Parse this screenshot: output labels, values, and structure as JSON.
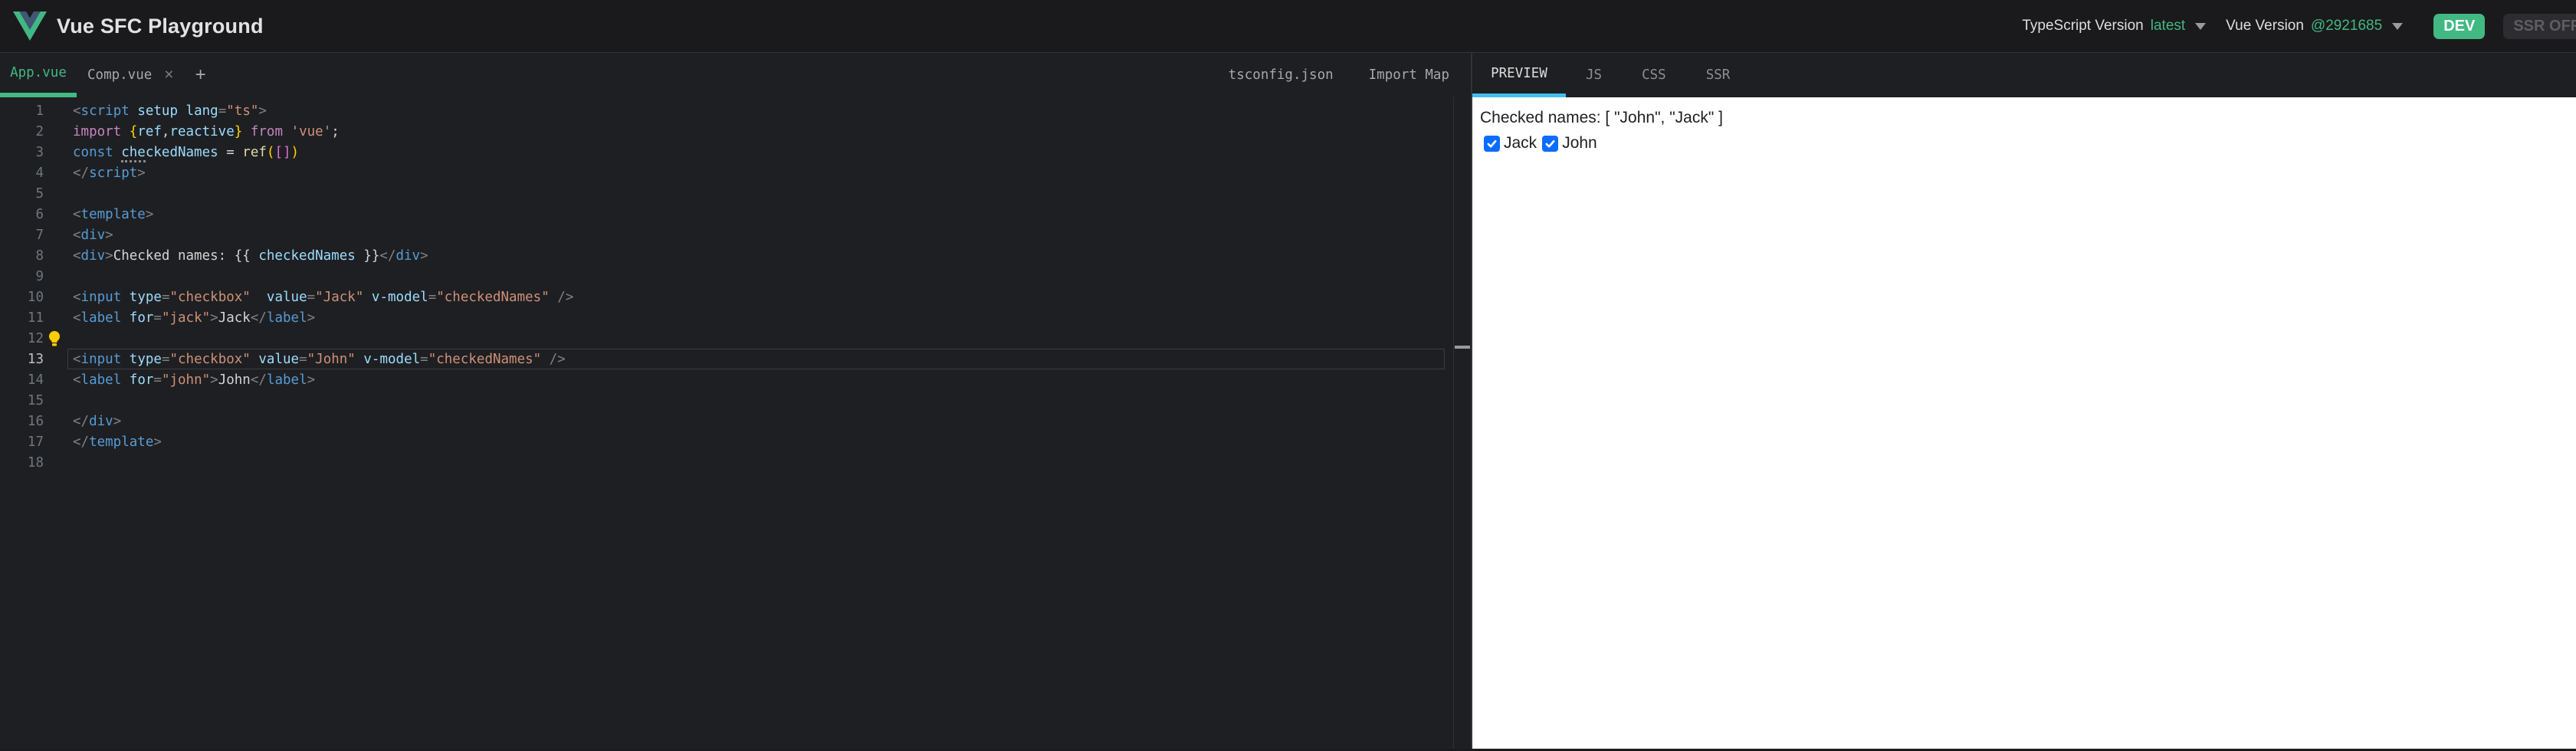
{
  "header": {
    "title": "Vue SFC Playground",
    "ts_version_label": "TypeScript Version",
    "ts_version_value": "latest",
    "vue_version_label": "Vue Version",
    "vue_version_value": "@2921685",
    "dev_badge": "DEV",
    "ssr_badge": "SSR OFF",
    "accent_green": "#42b883"
  },
  "file_tabs": {
    "tabs": [
      {
        "label": "App.vue",
        "active": true
      },
      {
        "label": "Comp.vue",
        "active": false,
        "closable": true
      }
    ],
    "close_label": "×",
    "add_label": "+",
    "right_items": [
      "tsconfig.json",
      "Import Map"
    ]
  },
  "output_tabs": {
    "tabs": [
      {
        "label": "PREVIEW",
        "active": true
      },
      {
        "label": "JS",
        "active": false
      },
      {
        "label": "CSS",
        "active": false
      },
      {
        "label": "SSR",
        "active": false
      }
    ],
    "active_underline_color": "#44bdf0"
  },
  "editor": {
    "current_line": 13,
    "lightbulb_line": 12,
    "lines": [
      {
        "segs": [
          [
            "pu",
            "<"
          ],
          [
            "tag",
            "script"
          ],
          [
            "pl",
            " "
          ],
          [
            "attr",
            "setup"
          ],
          [
            "pl",
            " "
          ],
          [
            "attr",
            "lang"
          ],
          [
            "pu",
            "="
          ],
          [
            "str",
            "\"ts\""
          ],
          [
            "pu",
            ">"
          ]
        ]
      },
      {
        "segs": [
          [
            "kw",
            "import"
          ],
          [
            "pl",
            " "
          ],
          [
            "b1",
            "{"
          ],
          [
            "ident",
            "ref"
          ],
          [
            "pl",
            ","
          ],
          [
            "ident",
            "reactive"
          ],
          [
            "b1",
            "}"
          ],
          [
            "pl",
            " "
          ],
          [
            "kw",
            "from"
          ],
          [
            "pl",
            " "
          ],
          [
            "str",
            "'vue'"
          ],
          [
            "pl",
            ";"
          ]
        ]
      },
      {
        "segs": [
          [
            "decl",
            "const"
          ],
          [
            "pl",
            " "
          ],
          [
            "ident hint",
            "che"
          ],
          [
            "ident",
            "ckedNames"
          ],
          [
            "pl",
            " = "
          ],
          [
            "fn",
            "ref"
          ],
          [
            "b1",
            "("
          ],
          [
            "b2",
            "[]"
          ],
          [
            "b1",
            ")"
          ]
        ]
      },
      {
        "segs": [
          [
            "pu",
            "</"
          ],
          [
            "tag",
            "script"
          ],
          [
            "pu",
            ">"
          ]
        ]
      },
      {
        "segs": []
      },
      {
        "segs": [
          [
            "pu",
            "<"
          ],
          [
            "tag",
            "template"
          ],
          [
            "pu",
            ">"
          ]
        ]
      },
      {
        "segs": [
          [
            "pu",
            "<"
          ],
          [
            "tag",
            "div"
          ],
          [
            "pu",
            ">"
          ]
        ]
      },
      {
        "segs": [
          [
            "pu",
            "<"
          ],
          [
            "tag",
            "div"
          ],
          [
            "pu",
            ">"
          ],
          [
            "pl",
            "Checked names: {{ "
          ],
          [
            "ident",
            "checkedNames"
          ],
          [
            "pl",
            " }}"
          ],
          [
            "pu",
            "</"
          ],
          [
            "tag",
            "div"
          ],
          [
            "pu",
            ">"
          ]
        ]
      },
      {
        "segs": []
      },
      {
        "segs": [
          [
            "pu",
            "<"
          ],
          [
            "tag",
            "input"
          ],
          [
            "pl",
            " "
          ],
          [
            "attr",
            "type"
          ],
          [
            "pu",
            "="
          ],
          [
            "str",
            "\"checkbox\""
          ],
          [
            "pl",
            "  "
          ],
          [
            "attr",
            "value"
          ],
          [
            "pu",
            "="
          ],
          [
            "str",
            "\"Jack\""
          ],
          [
            "pl",
            " "
          ],
          [
            "attr",
            "v-model"
          ],
          [
            "pu",
            "="
          ],
          [
            "str",
            "\"checkedNames\""
          ],
          [
            "pl",
            " "
          ],
          [
            "pu",
            "/>"
          ]
        ]
      },
      {
        "segs": [
          [
            "pu",
            "<"
          ],
          [
            "tag",
            "label"
          ],
          [
            "pl",
            " "
          ],
          [
            "attr",
            "for"
          ],
          [
            "pu",
            "="
          ],
          [
            "str",
            "\"jack\""
          ],
          [
            "pu",
            ">"
          ],
          [
            "pl",
            "Jack"
          ],
          [
            "pu",
            "</"
          ],
          [
            "tag",
            "label"
          ],
          [
            "pu",
            ">"
          ]
        ]
      },
      {
        "segs": []
      },
      {
        "segs": [
          [
            "pu",
            "<"
          ],
          [
            "tag",
            "input"
          ],
          [
            "pl",
            " "
          ],
          [
            "attr",
            "type"
          ],
          [
            "pu",
            "="
          ],
          [
            "str",
            "\"checkbox\""
          ],
          [
            "pl",
            " "
          ],
          [
            "attr",
            "value"
          ],
          [
            "pu",
            "="
          ],
          [
            "str",
            "\"John\""
          ],
          [
            "pl",
            " "
          ],
          [
            "attr",
            "v-model"
          ],
          [
            "pu",
            "="
          ],
          [
            "str",
            "\"checkedNames\""
          ],
          [
            "pl",
            " "
          ],
          [
            "pu",
            "/>"
          ]
        ]
      },
      {
        "segs": [
          [
            "pu",
            "<"
          ],
          [
            "tag",
            "label"
          ],
          [
            "pl",
            " "
          ],
          [
            "attr",
            "for"
          ],
          [
            "pu",
            "="
          ],
          [
            "str",
            "\"john\""
          ],
          [
            "pu",
            ">"
          ],
          [
            "pl",
            "John"
          ],
          [
            "pu",
            "</"
          ],
          [
            "tag",
            "label"
          ],
          [
            "pu",
            ">"
          ]
        ]
      },
      {
        "segs": []
      },
      {
        "segs": [
          [
            "pu",
            "</"
          ],
          [
            "tag",
            "div"
          ],
          [
            "pu",
            ">"
          ]
        ]
      },
      {
        "segs": [
          [
            "pu",
            "</"
          ],
          [
            "tag",
            "template"
          ],
          [
            "pu",
            ">"
          ]
        ]
      },
      {
        "segs": []
      }
    ]
  },
  "preview": {
    "output_text": "Checked names: [ \"John\", \"Jack\" ]",
    "checkbox_color": "#0b6cff",
    "checkboxes": [
      {
        "label": "Jack",
        "checked": true
      },
      {
        "label": "John",
        "checked": true
      }
    ]
  }
}
